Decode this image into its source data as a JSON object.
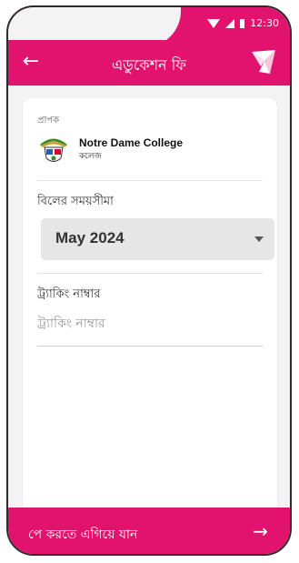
{
  "status_bar": {
    "time": "12:30",
    "wifi_icon": "wifi-icon",
    "signal_icon": "signal-icon",
    "battery_icon": "battery-icon"
  },
  "app_bar": {
    "title": "এডুকেশন ফি",
    "back_icon": "back-arrow-icon",
    "logo_icon": "bkash-bird-logo"
  },
  "recipient": {
    "label": "প্রাপক",
    "name": "Notre Dame College",
    "type": "কলেজ"
  },
  "billing": {
    "label": "বিলের সময়সীমা",
    "selected": "May 2024"
  },
  "tracking": {
    "label": "ট্র্যাকিং নাম্বার",
    "placeholder": "ট্র্যাকিং নাম্বার",
    "value": ""
  },
  "footer": {
    "pay_label": "পে করতে এগিয়ে যান",
    "arrow": "→"
  },
  "colors": {
    "brand": "#e2136e",
    "background": "#f3f3f3"
  }
}
